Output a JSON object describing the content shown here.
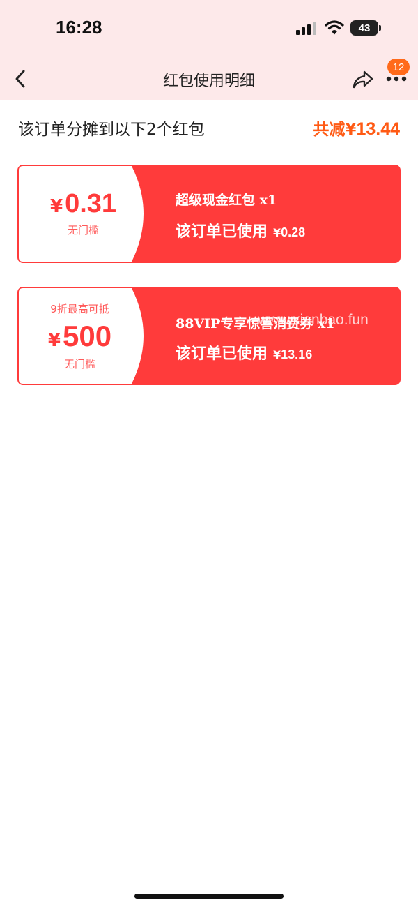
{
  "status_bar": {
    "time": "16:28",
    "battery": "43"
  },
  "nav": {
    "title": "红包使用明细",
    "badge_count": "12"
  },
  "summary": {
    "label": "该订单分摊到以下2个红包",
    "total_prefix": "共减¥",
    "total_amount": "13.44"
  },
  "coupons": [
    {
      "currency": "¥",
      "amount": "0.31",
      "condition": "无门槛",
      "name": "超级现金红包 x1",
      "used_label": "该订单已使用",
      "used_currency": "¥",
      "used_amount": "0.28"
    },
    {
      "top_note": "9折最高可抵",
      "currency": "¥",
      "amount": "500",
      "condition": "无门槛",
      "name": "88VIP专享惊喜消费券 x1",
      "used_label": "该订单已使用",
      "used_currency": "¥",
      "used_amount": "13.16"
    }
  ],
  "watermark": "www.xianbao.fun",
  "colors": {
    "accent_red": "#ff3b3b",
    "total_orange": "#ff5a14",
    "header_pink": "#fde9ea"
  },
  "icons": {
    "back": "chevron-left-icon",
    "share": "share-icon",
    "more": "more-dots-icon"
  }
}
